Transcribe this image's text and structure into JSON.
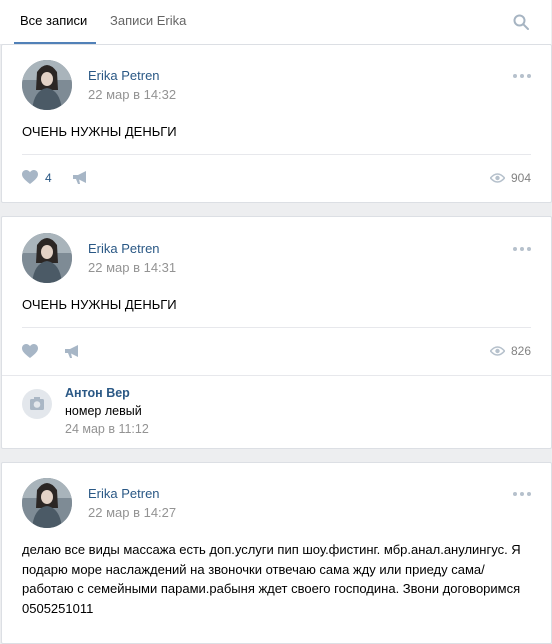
{
  "tabs": {
    "all": "Все записи",
    "user": "Записи Erika"
  },
  "icons": {
    "search": "search-icon",
    "more": "more-icon",
    "like": "heart-icon",
    "share": "megaphone-icon",
    "views": "eye-icon",
    "camera": "camera-icon"
  },
  "colors": {
    "link": "#2a5885",
    "accent": "#5181b8",
    "muted": "#939393",
    "icon": "#b6c1cc"
  },
  "posts": [
    {
      "author": "Erika Petren",
      "date": "22 мар в 14:32",
      "text": "ОЧЕНЬ НУЖНЫ ДЕНЬГИ",
      "likes": "4",
      "views": "904"
    },
    {
      "author": "Erika Petren",
      "date": "22 мар в 14:31",
      "text": "ОЧЕНЬ НУЖНЫ ДЕНЬГИ",
      "views": "826",
      "comment": {
        "author": "Антон Вер",
        "text": "номер левый",
        "date": "24 мар в 11:12"
      }
    },
    {
      "author": "Erika Petren",
      "date": "22 мар в 14:27",
      "text": "делаю все виды массажа есть доп.услуги пип шоу.фистинг. мбр.анал.анулингус. Я подарю море наслаждений на звоночки отвечаю сама жду или приеду сама/работаю с семейными парами.рабыня ждет своего господина. Звони договоримся 0505251011"
    }
  ]
}
